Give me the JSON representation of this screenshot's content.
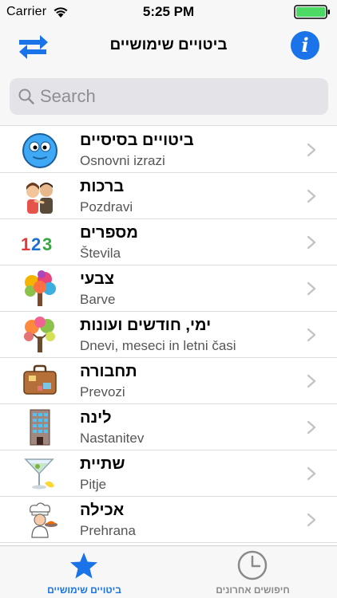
{
  "status_bar": {
    "carrier": "Carrier",
    "time": "5:25 PM"
  },
  "nav": {
    "title": "ביטויים שימושיים",
    "info_glyph": "i"
  },
  "search": {
    "placeholder": "Search",
    "value": ""
  },
  "list": {
    "items": [
      {
        "hebrew": "ביטויים בסיסיים",
        "slovene": "Osnovni izrazi",
        "icon": "smiley-face-icon"
      },
      {
        "hebrew": "ברכות",
        "slovene": "Pozdravi",
        "icon": "hugging-people-icon"
      },
      {
        "hebrew": "מספרים",
        "slovene": "Števila",
        "icon": "numbers-123-icon"
      },
      {
        "hebrew": "צבעי",
        "slovene": "Barve",
        "icon": "colorful-tree-icon"
      },
      {
        "hebrew": "ימי, חודשים ועונות",
        "slovene": "Dnevi, meseci in letni časi",
        "icon": "seasons-tree-icon"
      },
      {
        "hebrew": "תחבורה",
        "slovene": "Prevozi",
        "icon": "suitcase-icon"
      },
      {
        "hebrew": "לינה",
        "slovene": "Nastanitev",
        "icon": "hotel-building-icon"
      },
      {
        "hebrew": "שתיית",
        "slovene": "Pitje",
        "icon": "martini-glass-icon"
      },
      {
        "hebrew": "אכילה",
        "slovene": "Prehrana",
        "icon": "chef-icon"
      }
    ]
  },
  "tabs": [
    {
      "label": "ביטויים שימושיים",
      "icon": "star-icon",
      "active": true
    },
    {
      "label": "חיפושים אחרונים",
      "icon": "clock-icon",
      "active": false
    }
  ],
  "colors": {
    "accent": "#1a73e8",
    "bar_background": "#f7f7f7",
    "separator": "#dcdcdc",
    "battery": "#4cd964"
  }
}
